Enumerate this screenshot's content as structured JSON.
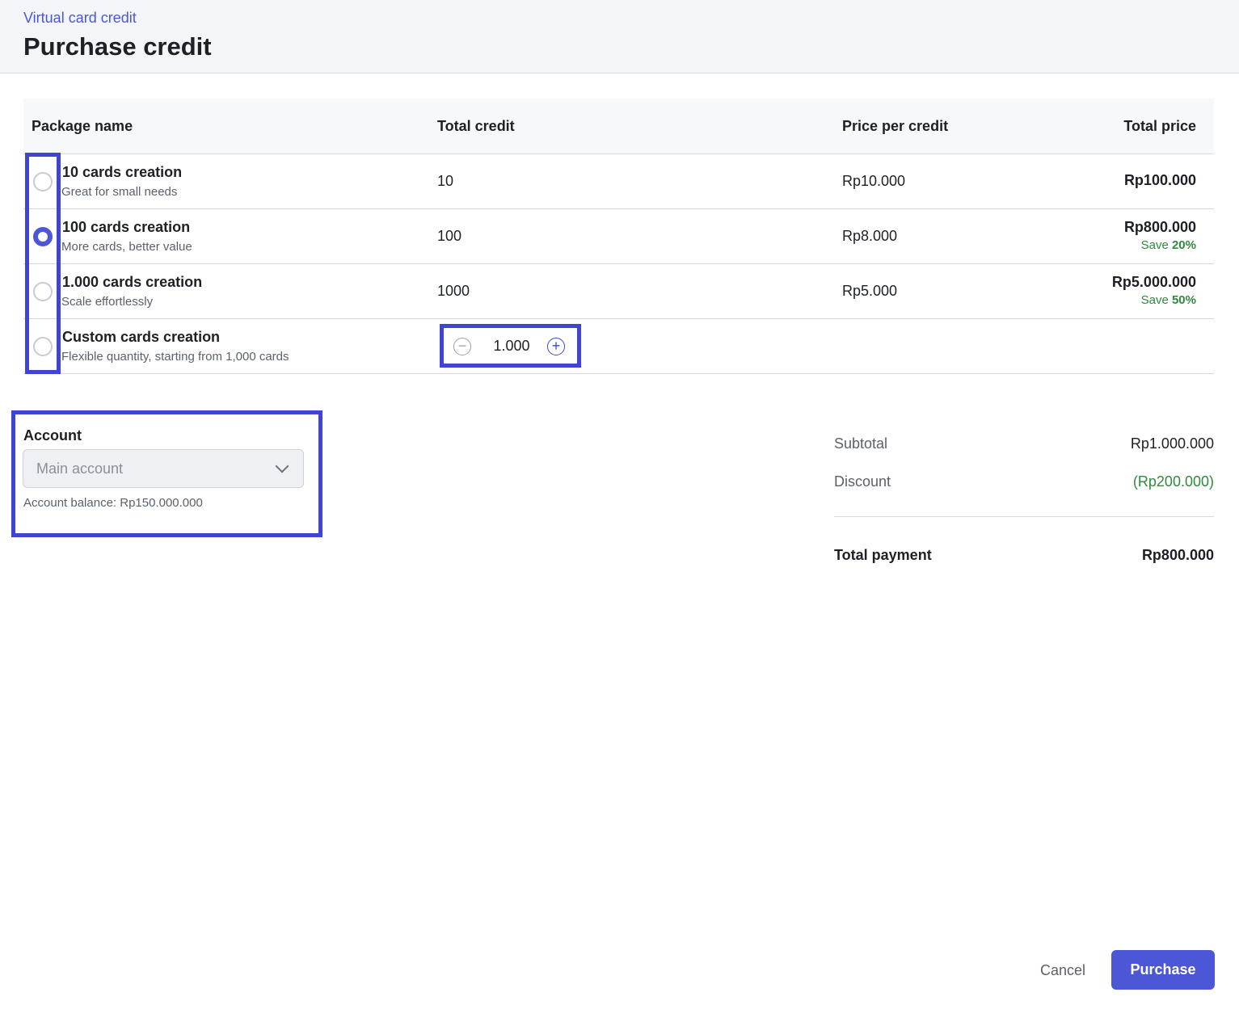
{
  "header": {
    "breadcrumb": "Virtual card credit",
    "title": "Purchase credit"
  },
  "table": {
    "columns": {
      "package_name": "Package name",
      "total_credit": "Total credit",
      "price_per_credit": "Price per credit",
      "total_price": "Total price"
    },
    "rows": [
      {
        "name": "10 cards creation",
        "desc": "Great for small needs",
        "credit": "10",
        "ppc": "Rp10.000",
        "total": "Rp100.000",
        "save_label": "",
        "save_pct": ""
      },
      {
        "name": "100 cards creation",
        "desc": "More cards, better value",
        "credit": "100",
        "ppc": "Rp8.000",
        "total": "Rp800.000",
        "save_label": "Save",
        "save_pct": "20%"
      },
      {
        "name": "1.000 cards creation",
        "desc": "Scale effortlessly",
        "credit": "1000",
        "ppc": "Rp5.000",
        "total": "Rp5.000.000",
        "save_label": "Save",
        "save_pct": "50%"
      },
      {
        "name": "Custom cards creation",
        "desc": "Flexible quantity, starting from 1,000 cards",
        "stepper_value": "1.000"
      }
    ],
    "selected_index": 1
  },
  "icons": {
    "minus": "minus-circle-icon",
    "plus": "plus-circle-icon",
    "chevron": "chevron-down-icon"
  },
  "account": {
    "label": "Account",
    "selected": "Main account",
    "balance": "Account balance: Rp150.000.000"
  },
  "summary": {
    "subtotal_label": "Subtotal",
    "subtotal_value": "Rp1.000.000",
    "discount_label": "Discount",
    "discount_value": "(Rp200.000)",
    "total_label": "Total payment",
    "total_value": "Rp800.000"
  },
  "actions": {
    "cancel": "Cancel",
    "purchase": "Purchase"
  },
  "colors": {
    "accent": "#4b57d6",
    "highlight": "#3f44d2",
    "success": "#2f8a3b"
  }
}
